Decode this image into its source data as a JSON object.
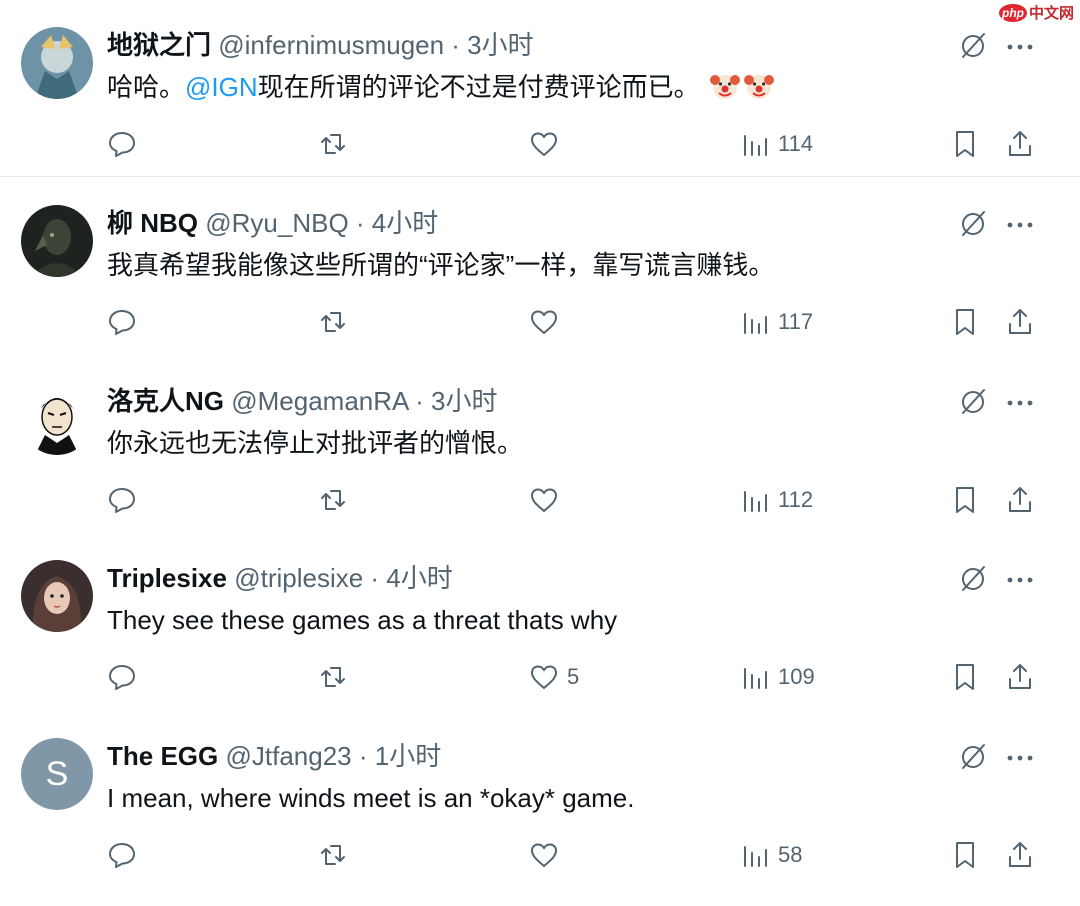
{
  "watermark": {
    "logo_text": "php",
    "text": "中文网"
  },
  "colors": {
    "mention": "#1d9bf0",
    "meta": "#536471",
    "text": "#0f1419"
  },
  "tweets": [
    {
      "name": "地狱之门",
      "meta": "@infernimusmugen · 3小时",
      "text_before": "哈哈。",
      "mention": "@IGN",
      "text_after": "现在所谓的评论不过是付费评论而已。",
      "emoji": [
        "clown-face-icon",
        "clown-face-icon"
      ],
      "likes": "",
      "views": "114"
    },
    {
      "name": "柳 NBQ",
      "meta": "@Ryu_NBQ · 4小时",
      "text_before": "我真希望我能像这些所谓的“评论家”一样，靠写谎言赚钱。",
      "mention": "",
      "text_after": "",
      "likes": "",
      "views": "117"
    },
    {
      "name": "洛克人NG",
      "meta": "@MegamanRA · 3小时",
      "text_before": "你永远也无法停止对批评者的憎恨。",
      "mention": "",
      "text_after": "",
      "likes": "",
      "views": "112"
    },
    {
      "name": "Triplesixe",
      "meta": "@triplesixe · 4小时",
      "text_before": "They see these games as a threat thats why",
      "mention": "",
      "text_after": "",
      "likes": "5",
      "views": "109"
    },
    {
      "name": "The EGG",
      "meta": "@Jtfang23 · 1小时",
      "avatar_letter": "S",
      "text_before": "I mean, where winds meet is an *okay* game.",
      "mention": "",
      "text_after": "",
      "likes": "",
      "views": "58"
    }
  ]
}
